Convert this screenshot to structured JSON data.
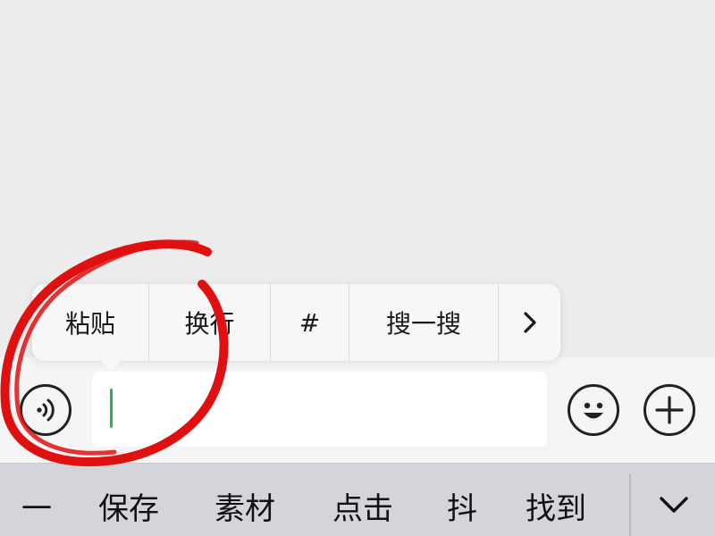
{
  "context_menu": {
    "items": [
      {
        "label": "粘贴"
      },
      {
        "label": "换行"
      },
      {
        "label": "#"
      },
      {
        "label": "搜一搜"
      }
    ],
    "more_icon": "chevron-right-icon"
  },
  "input_bar": {
    "voice_icon": "voice-icon",
    "text_value": "",
    "emoji_icon": "emoji-icon",
    "plus_icon": "plus-icon"
  },
  "keyboard_suggestions": {
    "items": [
      "一",
      "保存",
      "素材",
      "点击",
      "抖",
      "找到"
    ],
    "collapse_icon": "chevron-down-icon"
  },
  "annotation": {
    "shape": "hand-drawn-circle",
    "color": "#e01010"
  },
  "colors": {
    "cursor": "#2fb24a",
    "background": "#ededed",
    "keyboard_bar": "#d3d5da"
  }
}
